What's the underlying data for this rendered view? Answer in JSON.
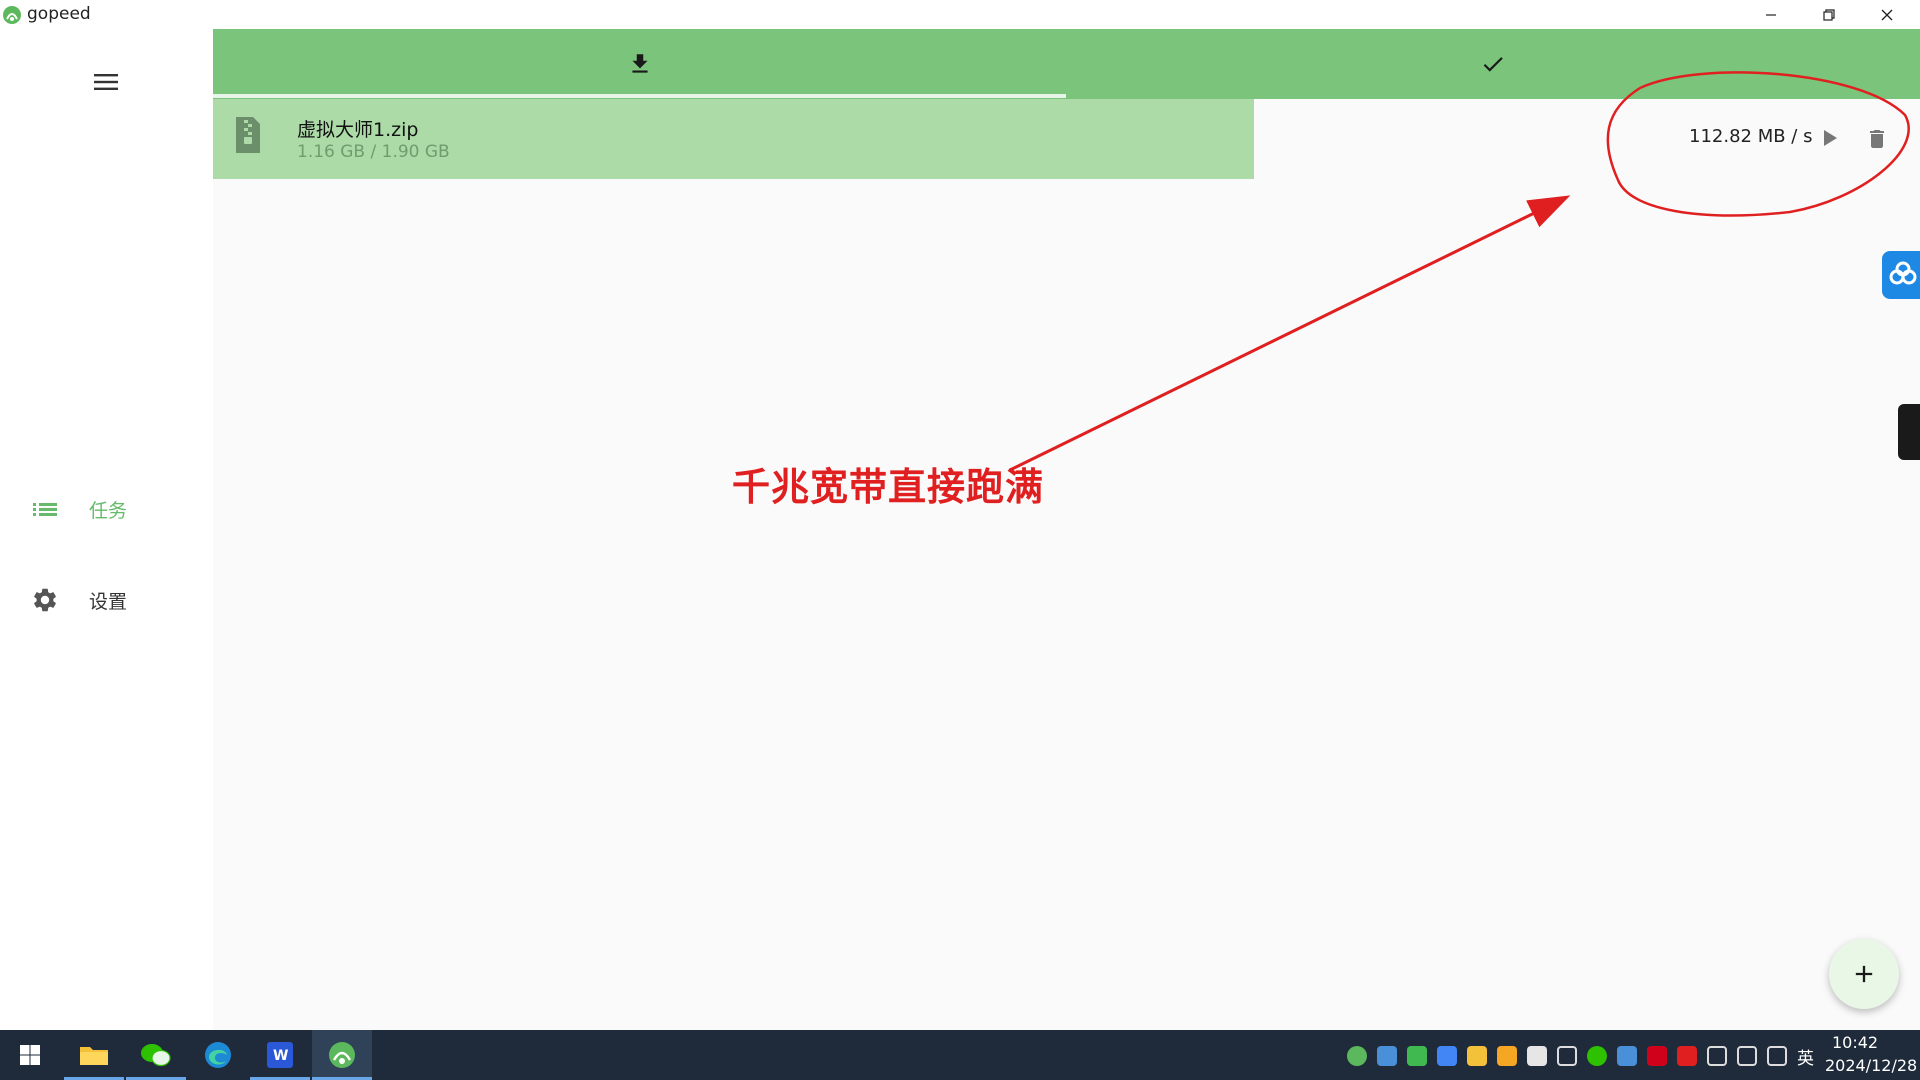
{
  "window": {
    "title": "gopeed"
  },
  "sidebar": {
    "items": [
      {
        "label": "任务",
        "icon": "list-icon",
        "active": true
      },
      {
        "label": "设置",
        "icon": "gear-icon",
        "active": false
      }
    ]
  },
  "tabs": [
    {
      "icon": "download-icon",
      "active": true
    },
    {
      "icon": "check-icon",
      "active": false
    }
  ],
  "tasks": [
    {
      "name": "虚拟大师1.zip",
      "size": "1.16 GB / 1.90 GB",
      "speed": "112.82 MB / s",
      "progress": 0.61
    }
  ],
  "annotation": {
    "text": "千兆宽带直接跑满",
    "color": "#e02020"
  },
  "colors": {
    "accent": "#7bc47b",
    "progress": "#acdba8",
    "active_nav": "#66bb6a"
  },
  "taskbar": {
    "apps": [
      "start-icon",
      "file-explorer-icon",
      "wechat-icon",
      "edge-icon",
      "word-icon",
      "gopeed-icon"
    ],
    "input_lang": "英",
    "time": "10:42",
    "date": "2024/12/28"
  }
}
